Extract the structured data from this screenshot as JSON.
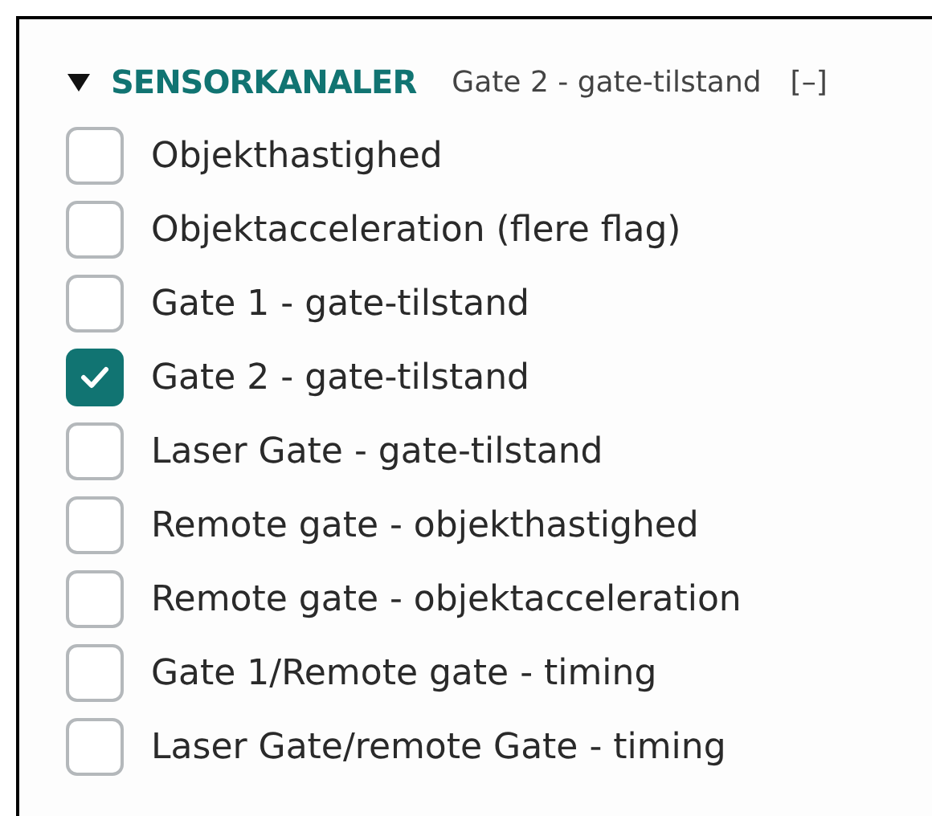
{
  "section": {
    "title": "SENSORKANALER",
    "expanded": true,
    "summary": "Gate 2 - gate-tilstand",
    "toggle": "[–]"
  },
  "channels": [
    {
      "label": "Objekthastighed",
      "checked": false
    },
    {
      "label": "Objektacceleration (flere flag)",
      "checked": false
    },
    {
      "label": "Gate 1 - gate-tilstand",
      "checked": false
    },
    {
      "label": "Gate 2 - gate-tilstand",
      "checked": true
    },
    {
      "label": "Laser Gate - gate-tilstand",
      "checked": false
    },
    {
      "label": "Remote gate - objekthastighed",
      "checked": false
    },
    {
      "label": "Remote gate - objektacceleration",
      "checked": false
    },
    {
      "label": "Gate 1/Remote gate - timing",
      "checked": false
    },
    {
      "label": "Laser Gate/remote Gate - timing",
      "checked": false
    }
  ]
}
